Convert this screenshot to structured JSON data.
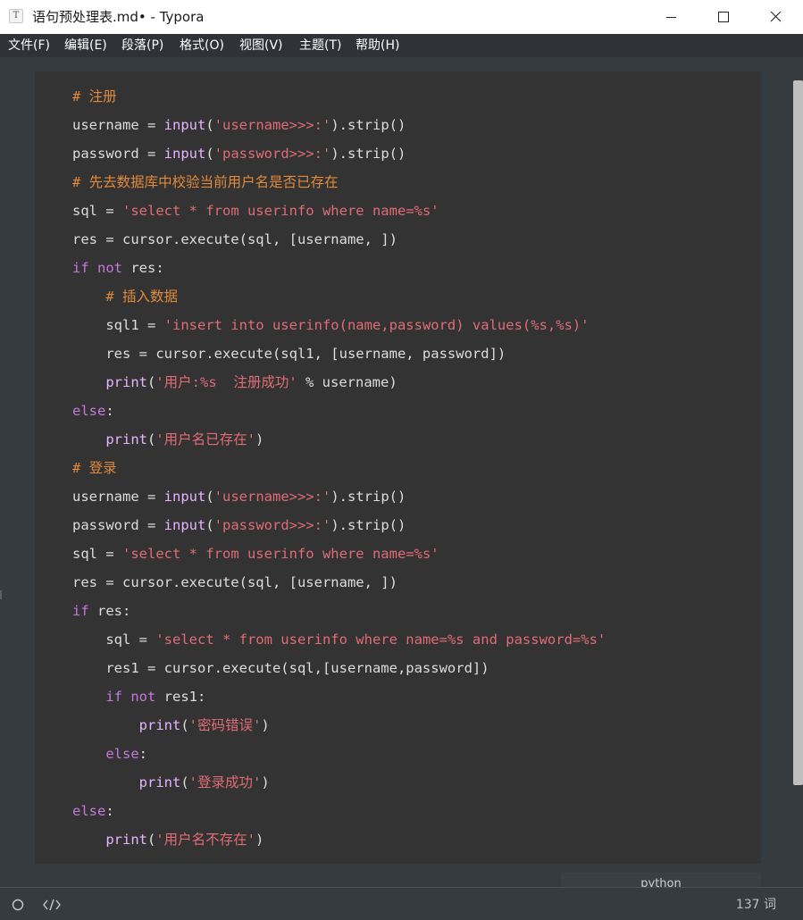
{
  "window": {
    "title": "语句预处理表.md• - Typora",
    "app_icon_letter": "T",
    "controls": {
      "minimize": "minimize-icon",
      "maximize": "maximize-icon",
      "close": "close-icon"
    }
  },
  "menu": {
    "items": [
      {
        "label": "文件(F)"
      },
      {
        "label": "编辑(E)"
      },
      {
        "label": "段落(P)"
      },
      {
        "label": "格式(O)"
      },
      {
        "label": "视图(V)"
      },
      {
        "label": "主题(T)"
      },
      {
        "label": "帮助(H)"
      }
    ]
  },
  "code": {
    "language": "python",
    "lines": [
      "# 注册",
      "username = input('username>>>:').strip()",
      "password = input('password>>>:').strip()",
      "# 先去数据库中校验当前用户名是否已存在",
      "sql = 'select * from userinfo where name=%s'",
      "res = cursor.execute(sql, [username, ])",
      "if not res:",
      "    # 插入数据",
      "    sql1 = 'insert into userinfo(name,password) values(%s,%s)'",
      "    res = cursor.execute(sql1, [username, password])",
      "    print('用户:%s  注册成功' % username)",
      "else:",
      "    print('用户名已存在')",
      "# 登录",
      "username = input('username>>>:').strip()",
      "password = input('password>>>:').strip()",
      "sql = 'select * from userinfo where name=%s'",
      "res = cursor.execute(sql, [username, ])",
      "if res:",
      "    sql = 'select * from userinfo where name=%s and password=%s'",
      "    res1 = cursor.execute(sql,[username,password])",
      "    if not res1:",
      "        print('密码错误')",
      "    else:",
      "        print('登录成功')",
      "else:",
      "    print('用户名不存在')"
    ]
  },
  "status": {
    "word_count": "137 词",
    "left_icons": [
      "sidebar-toggle-icon",
      "source-code-icon"
    ]
  },
  "colors": {
    "editor_bg": "#363b40",
    "code_bg": "#333333",
    "keyword": "#c678dd",
    "function": "#e8b4ff",
    "string": "#e06c75",
    "comment": "#e08a3c",
    "text": "#dddddd"
  }
}
